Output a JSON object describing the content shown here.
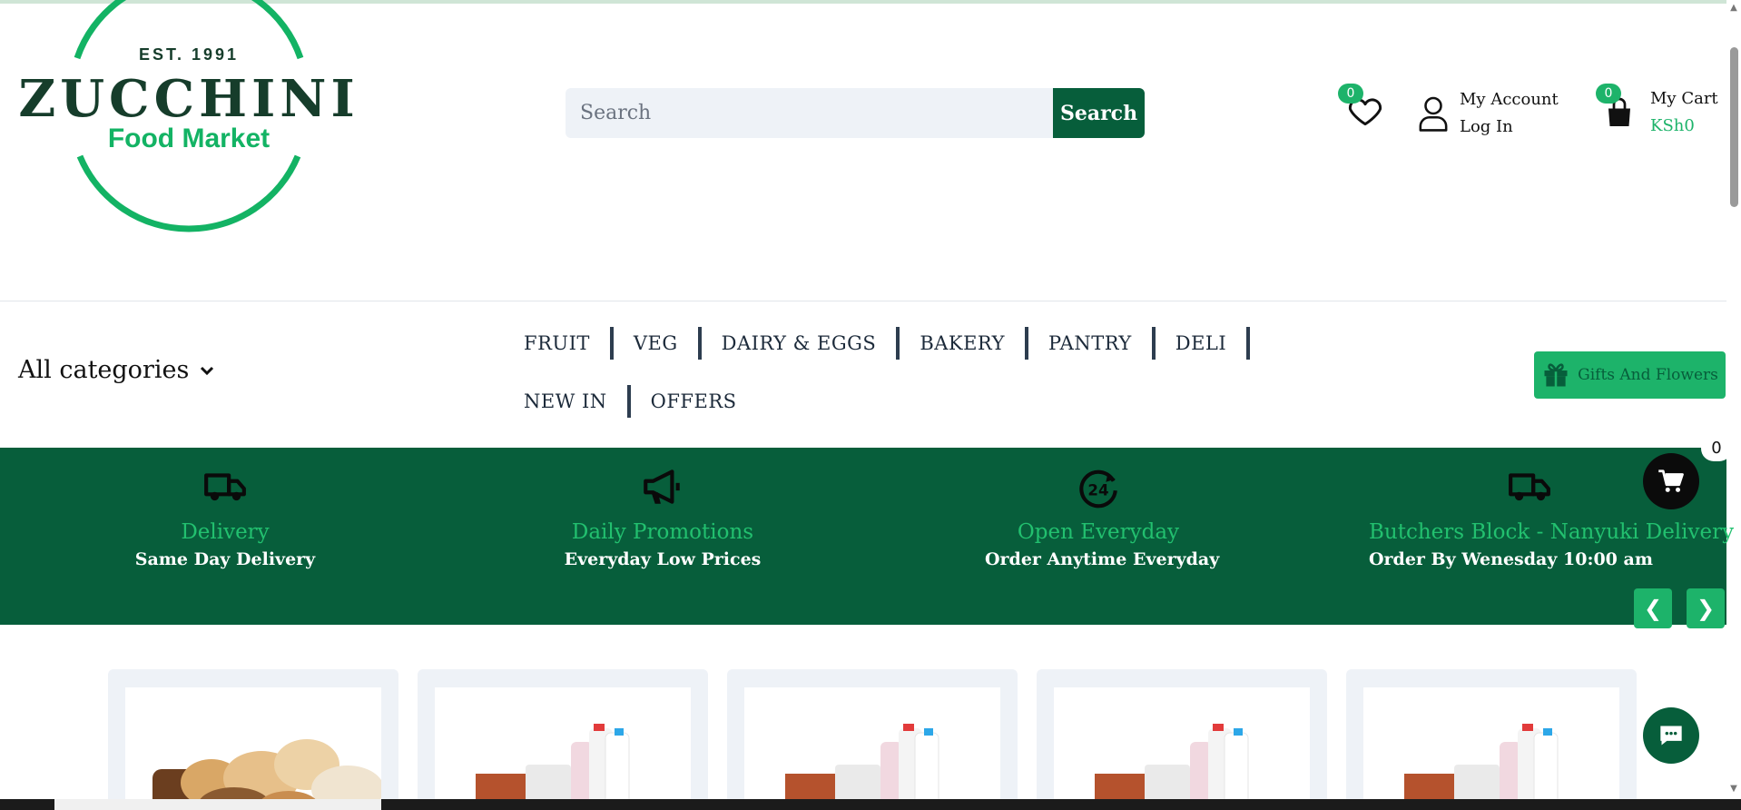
{
  "logo": {
    "est": "EST. 1991",
    "name": "ZUCCHINI",
    "tagline": "Food Market"
  },
  "search": {
    "placeholder": "Search",
    "button_label": "Search"
  },
  "wishlist": {
    "count": "0"
  },
  "account": {
    "label": "My Account",
    "action": "Log In"
  },
  "cart": {
    "label": "My Cart",
    "total": "KSh0",
    "count": "0"
  },
  "nav": {
    "all_categories": "All categories",
    "menu": [
      "FRUIT",
      "VEG",
      "DAIRY & EGGS",
      "BAKERY",
      "PANTRY",
      "DELI",
      "NEW IN",
      "OFFERS"
    ],
    "gifts_label": "Gifts And Flowers"
  },
  "features": [
    {
      "title": "Delivery",
      "subtitle": "Same Day Delivery",
      "icon": "truck-icon"
    },
    {
      "title": "Daily Promotions",
      "subtitle": "Everyday Low Prices",
      "icon": "megaphone-icon"
    },
    {
      "title": "Open Everyday",
      "subtitle": "Order Anytime Everyday",
      "icon": "24-hours-icon"
    },
    {
      "title": "Butchers Block - Nanyuki Delivery",
      "subtitle": "Order By Wenesday 10:00 am",
      "icon": "truck-icon"
    }
  ],
  "carousel": {
    "prev": "❮",
    "next": "❯"
  },
  "floating_cart": {
    "count": "0"
  },
  "colors": {
    "brand_dark": "#075e3b",
    "brand_green": "#1db36a",
    "accent_light": "#22c06f"
  }
}
